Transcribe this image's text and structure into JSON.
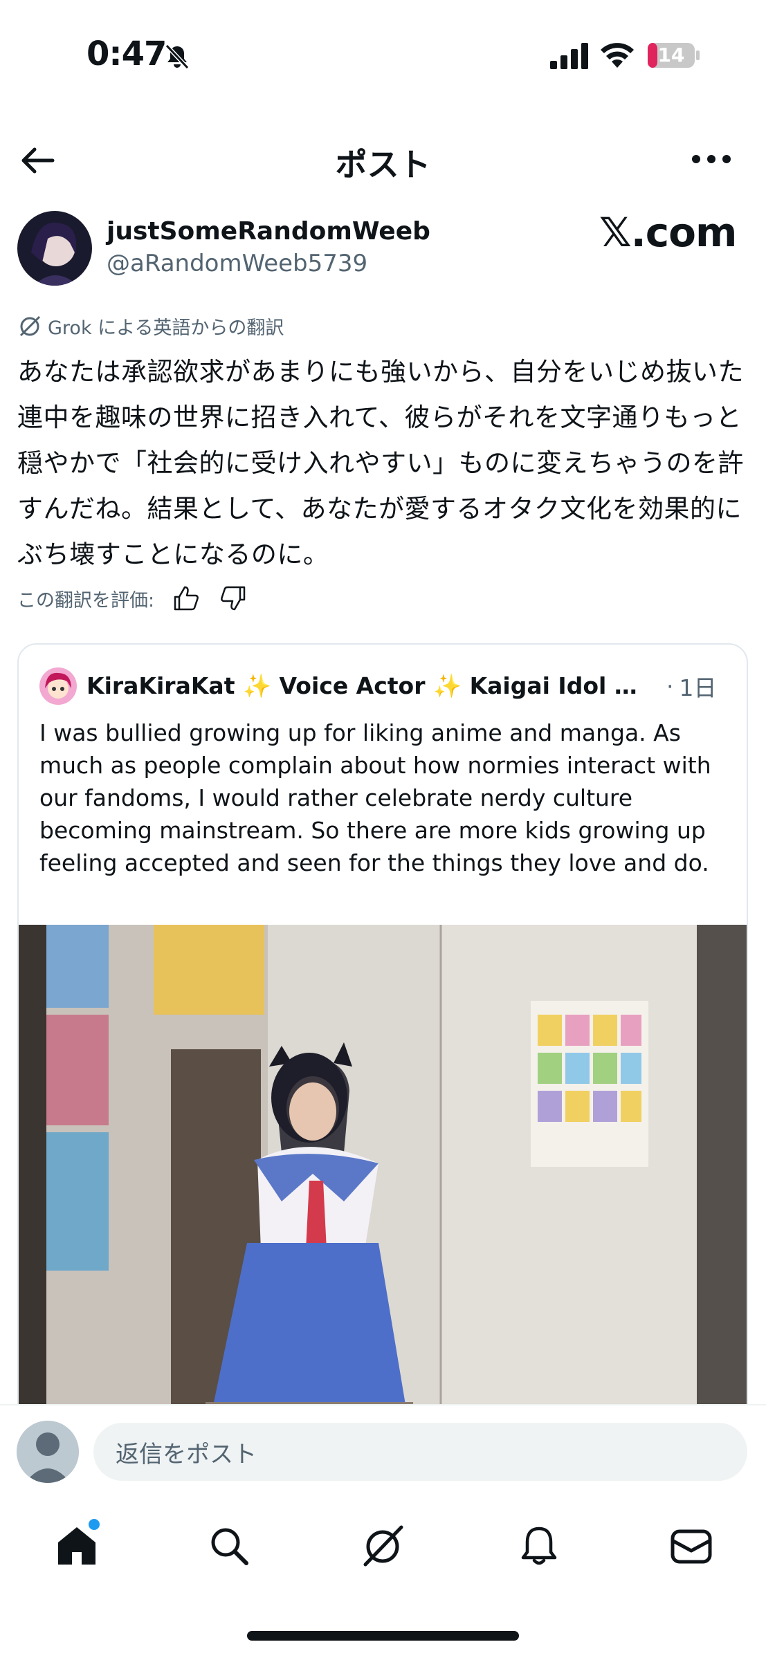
{
  "status_bar": {
    "time": "0:47",
    "battery": "14"
  },
  "header": {
    "title": "ポスト"
  },
  "author": {
    "name": "justSomeRandomWeeb",
    "handle": "@aRandomWeeb5739",
    "badge": "𝕏.com"
  },
  "translation": {
    "note": "Grok による英語からの翻訳",
    "text": "あなたは承認欲求があまりにも強いから、自分をいじめ抜いた連中を趣味の世界に招き入れて、彼らがそれを文字通りもっと穏やかで「社会的に受け入れやすい」ものに変えちゃうのを許すんだね。結果として、あなたが愛するオタク文化を効果的にぶち壊すことになるのに。",
    "rate_label": "この翻訳を評価:"
  },
  "quote": {
    "name": "KiraKiraKat ✨ Voice Actor ✨ Kaigai Idol ✨ …",
    "separator": "·",
    "time": "1日",
    "text": "I was bullied growing up for liking anime and manga. As much as people complain about how normies interact with our fandoms, I would rather celebrate nerdy culture becoming mainstream. So there are more kids growing up feeling accepted and seen for the things they love and do."
  },
  "reply": {
    "placeholder": "返信をポスト"
  },
  "tabs": [
    {
      "icon": "home-icon",
      "active": true,
      "has_dot": true
    },
    {
      "icon": "search-icon"
    },
    {
      "icon": "grok-icon"
    },
    {
      "icon": "notifications-icon"
    },
    {
      "icon": "messages-icon"
    }
  ],
  "colors": {
    "accent": "#1d9bf0",
    "text": "#0f1419",
    "secondary": "#536471",
    "battery_low": "#e0245e"
  }
}
